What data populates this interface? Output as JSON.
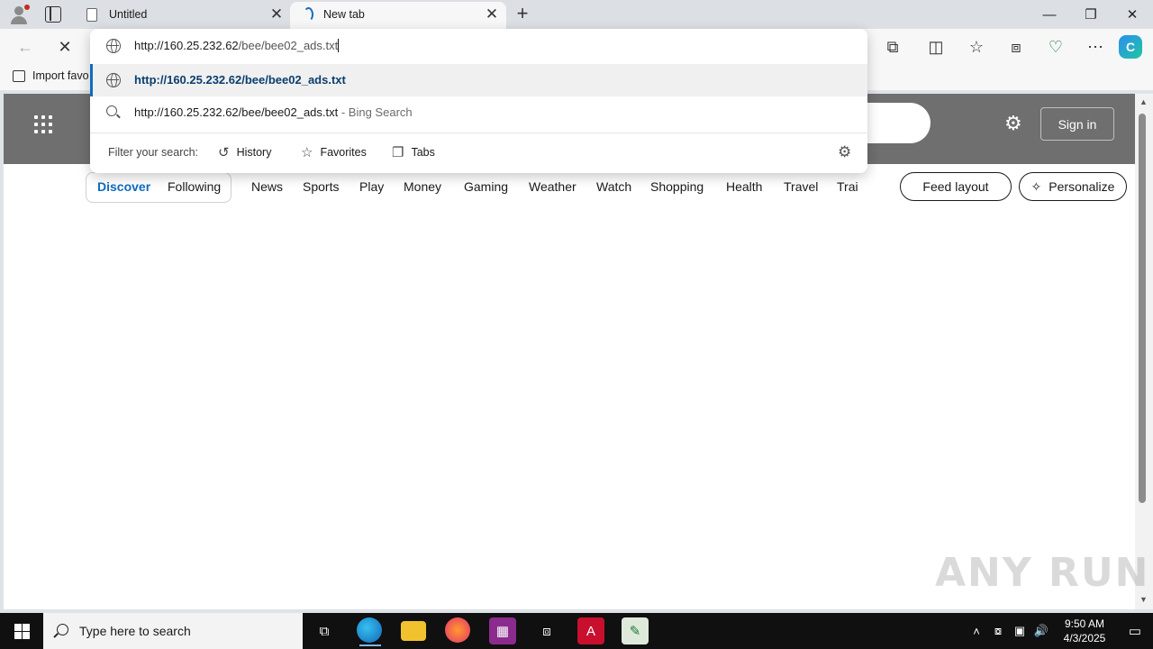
{
  "tabs": [
    {
      "label": "Untitled",
      "close": "✕"
    },
    {
      "label": "New tab",
      "close": "✕"
    }
  ],
  "window": {
    "minimize": "—",
    "maximize": "❐",
    "close": "✕"
  },
  "toolbar": {
    "back": "←",
    "stop": "✕",
    "extensions": "⧉",
    "split": "◫",
    "favorites": "☆",
    "collections": "⧈",
    "performance": "♡",
    "more": "⋯",
    "copilot": "C"
  },
  "favbar": {
    "import_label": "Import favo"
  },
  "omnibox": {
    "url_host": "http://160.25.232.62",
    "url_path": "/bee/bee02_ads.txt",
    "suggestion_url": "http://160.25.232.62/bee/bee02_ads.txt",
    "suggestion_search": "http://160.25.232.62/bee/bee02_ads.txt",
    "search_suffix": " - Bing Search",
    "filter_label": "Filter your search:",
    "filters": [
      {
        "label": "History",
        "icon": "history-icon"
      },
      {
        "label": "Favorites",
        "icon": "star-icon"
      },
      {
        "label": "Tabs",
        "icon": "tabs-icon"
      }
    ]
  },
  "page": {
    "sign_in": "Sign in",
    "nav": [
      "Discover",
      "Following",
      "News",
      "Sports",
      "Play",
      "Money",
      "Gaming",
      "Weather",
      "Watch",
      "Shopping",
      "Health",
      "Travel",
      "Trai"
    ],
    "feed_layout": "Feed layout",
    "personalize": "Personalize"
  },
  "taskbar": {
    "search_placeholder": "Type here to search",
    "time": "9:50 AM",
    "date": "4/3/2025"
  },
  "watermark": "ANY RUN",
  "colors": {
    "accent": "#0f6cbd",
    "hero": "#6f6f6f",
    "taskbar": "#101010"
  }
}
